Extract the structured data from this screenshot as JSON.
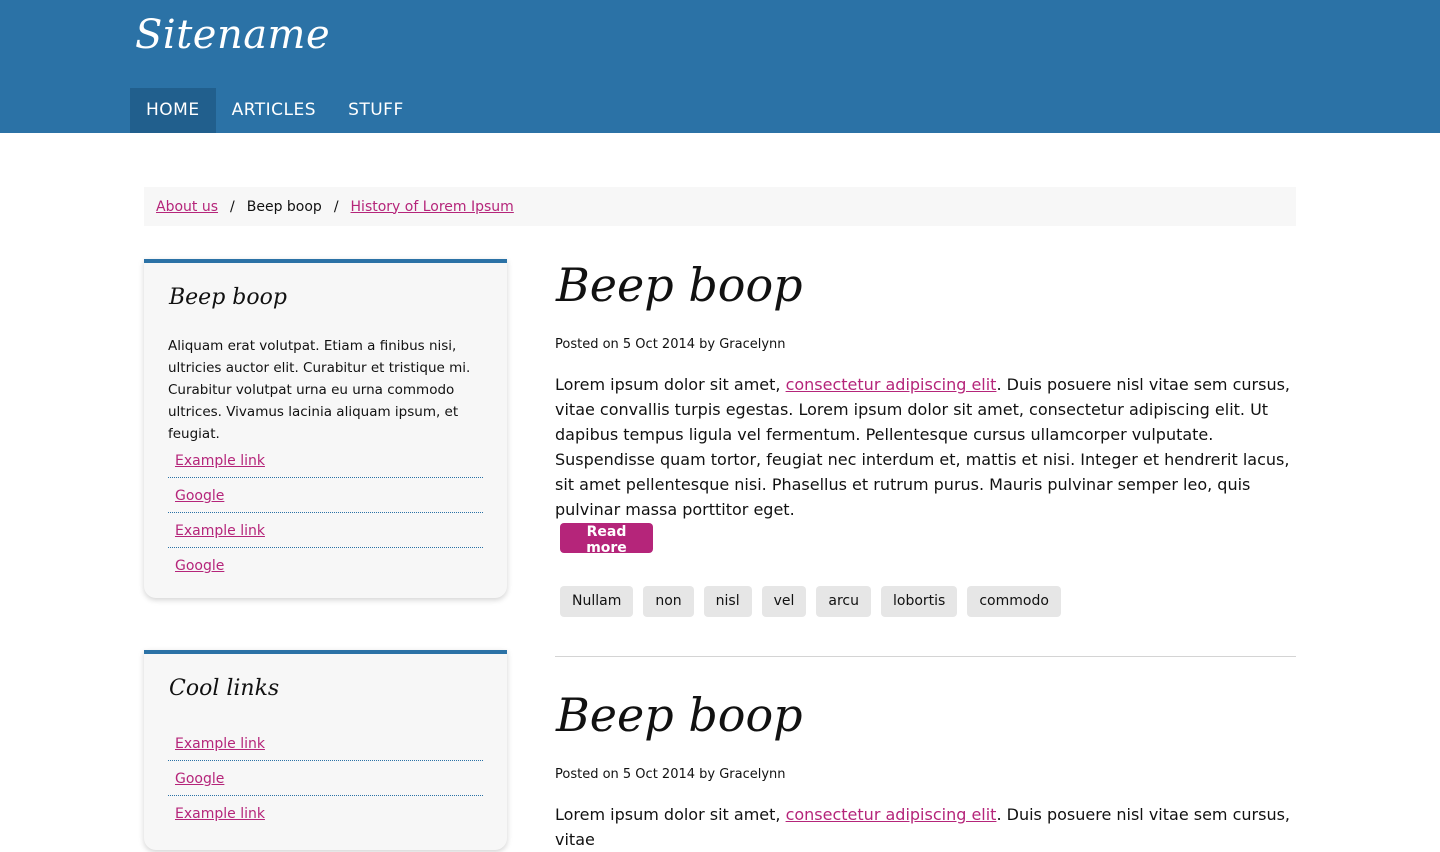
{
  "site": {
    "name": "Sitename"
  },
  "nav": {
    "items": [
      {
        "label": "HOME"
      },
      {
        "label": "ARTICLES"
      },
      {
        "label": "STUFF"
      }
    ]
  },
  "breadcrumb": {
    "items": [
      {
        "label": "About us"
      },
      {
        "label": "Beep boop"
      },
      {
        "label": "History of Lorem Ipsum"
      }
    ],
    "separator": "/"
  },
  "sidebar": {
    "widgets": [
      {
        "title": "Beep boop",
        "text": "Aliquam erat volutpat. Etiam a finibus nisi, ultricies auctor elit. Curabitur et tristique mi. Curabitur volutpat urna eu urna commodo ultrices. Vivamus lacinia aliquam ipsum, et feugiat.",
        "links": [
          {
            "label": "Example link"
          },
          {
            "label": "Google"
          },
          {
            "label": "Example link"
          },
          {
            "label": "Google"
          }
        ]
      },
      {
        "title": "Cool links",
        "links": [
          {
            "label": "Example link"
          },
          {
            "label": "Google"
          },
          {
            "label": "Example link"
          }
        ]
      }
    ]
  },
  "posts": [
    {
      "title": "Beep boop",
      "meta": "Posted on 5 Oct 2014 by Gracelynn",
      "body_before": "Lorem ipsum dolor sit amet, ",
      "body_link": "consectetur adipiscing elit",
      "body_after": ". Duis posuere nisl vitae sem cursus, vitae convallis turpis egestas. Lorem ipsum dolor sit amet, consectetur adipiscing elit. Ut dapibus tempus ligula vel fermentum. Pellentesque cursus ullamcorper vulputate. Suspendisse quam tortor, feugiat nec interdum et, mattis et nisi. Integer et hendrerit lacus, sit amet pellentesque nisi. Phasellus et rutrum purus. Mauris pulvinar semper leo, quis pulvinar massa porttitor eget.",
      "read_more": "Read more",
      "tags": [
        "Nullam",
        "non",
        "nisl",
        "vel",
        "arcu",
        "lobortis",
        "commodo"
      ]
    },
    {
      "title": "Beep boop",
      "meta": "Posted on 5 Oct 2014 by Gracelynn",
      "body_before": "Lorem ipsum dolor sit amet, ",
      "body_link": "consectetur adipiscing elit",
      "body_after": ". Duis posuere nisl vitae sem cursus, vitae"
    }
  ],
  "colors": {
    "header": "#2b72a6",
    "nav_active": "#215f8d",
    "accent": "#b5257a",
    "tag_bg": "#e6e6e6"
  }
}
